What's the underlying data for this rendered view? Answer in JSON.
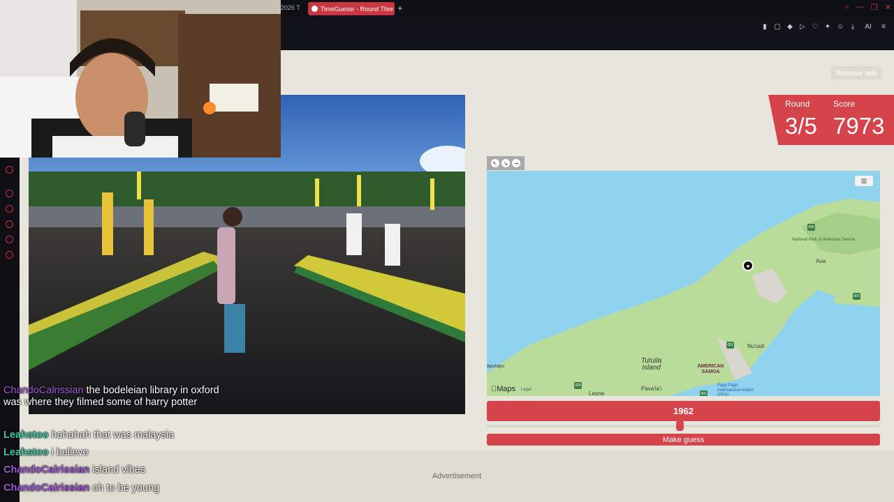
{
  "browser": {
    "prev_tab_label": "2026 T",
    "active_tab_label": "TimeGuessr - Round Thre",
    "new_tab_symbol": "+",
    "ai_label": "AI"
  },
  "header": {
    "remove_ads_label": "Remove ads"
  },
  "score": {
    "round_label": "Round",
    "round_value": "3/5",
    "score_label": "Score",
    "score_value": "7973"
  },
  "map": {
    "logo_label": "Maps",
    "legal_label": "Legal",
    "labels": {
      "park": "National Park of American Samoa",
      "aua": "Aua",
      "nuuuli": "Nu'uuli",
      "tutuila": "Tutuila Island",
      "american_samoa": "AMERICAN SAMOA",
      "pavaiai": "Pava'ia'i",
      "leone": "Leone",
      "airport": "Pago Pago International Airport (PPG)",
      "faleasao": "aputapu"
    },
    "shields": [
      "006",
      "001",
      "001",
      "009",
      "001"
    ]
  },
  "guess": {
    "year": "1962",
    "slider_fraction": 0.49,
    "button_label": "Make guess"
  },
  "footer": {
    "ad_label": "Advertisement"
  },
  "chat": {
    "messages": [
      {
        "user": "ChandoCalrissian",
        "color": "#a25ad6",
        "text": "the bodeleian library in oxford was where they filmed some of harry potter"
      },
      {
        "user": "Leahstoo",
        "color": "#3fc8a6",
        "text": "hahahah that was malaysia"
      },
      {
        "user": "Leahstoo",
        "color": "#3fc8a6",
        "text": "i believe"
      },
      {
        "user": "ChandoCalrissian",
        "color": "#a25ad6",
        "text": "island vibes"
      },
      {
        "user": "ChandoCalrissian",
        "color": "#a25ad6",
        "text": "oh to be young"
      }
    ]
  },
  "colors": {
    "accent": "#d4444a",
    "page_bg": "#e8e6dc",
    "ocean": "#8fd3ee",
    "land": "#b9dc9a"
  }
}
